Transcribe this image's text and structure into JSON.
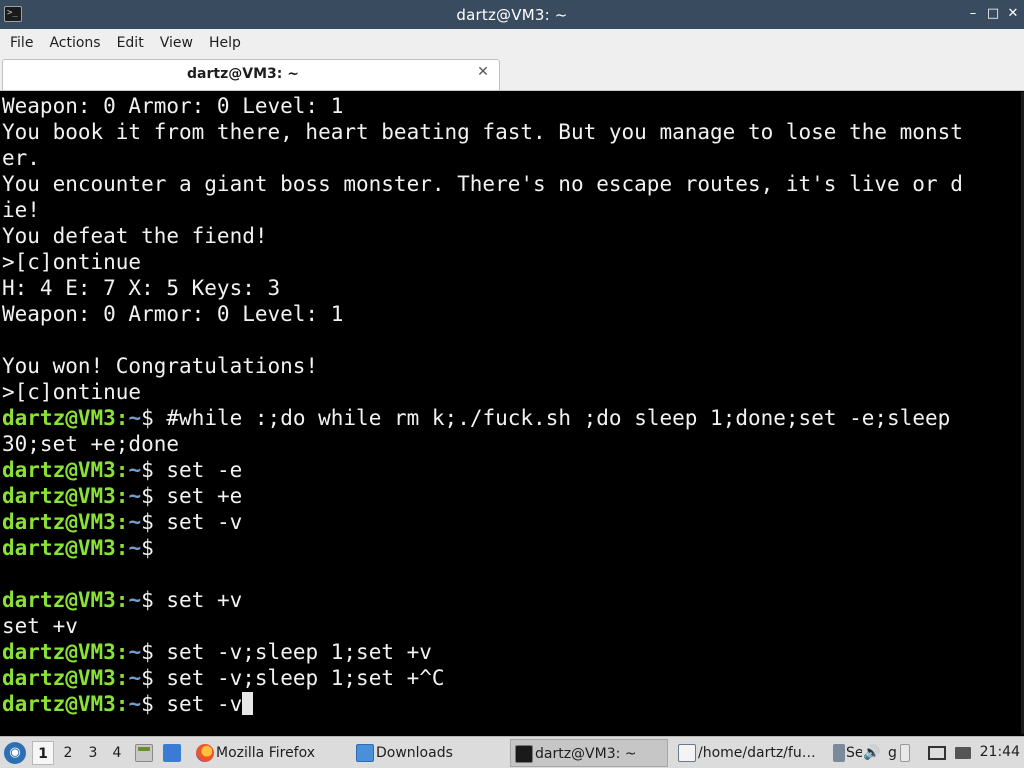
{
  "window": {
    "title": "dartz@VM3: ~",
    "icon_label": ">_",
    "controls": {
      "minimize": "–",
      "maximize": "□",
      "close": "✕"
    }
  },
  "menubar": {
    "items": [
      "File",
      "Actions",
      "Edit",
      "View",
      "Help"
    ]
  },
  "tabs": [
    {
      "label": "dartz@VM3: ~",
      "close": "✕"
    }
  ],
  "terminal": {
    "colors": {
      "user": "#8ae234",
      "path": "#729fcf",
      "text": "#f2f2f2",
      "background": "#000000"
    },
    "prompt": {
      "user": "dartz@VM3",
      "sep": ":",
      "path": "~",
      "symbol": "$ "
    },
    "lines": [
      {
        "text": "Weapon: 0 Armor: 0 Level: 1"
      },
      {
        "text": "You book it from there, heart beating fast. But you manage to lose the monst"
      },
      {
        "text": "er."
      },
      {
        "text": "You encounter a giant boss monster. There's no escape routes, it's live or d"
      },
      {
        "text": "ie!"
      },
      {
        "text": "You defeat the fiend!"
      },
      {
        "text": ">[c]ontinue"
      },
      {
        "text": "H: 4 E: 7 X: 5 Keys: 3"
      },
      {
        "text": "Weapon: 0 Armor: 0 Level: 1"
      },
      {
        "text": ""
      },
      {
        "text": "You won! Congratulations!"
      },
      {
        "text": ">[c]ontinue"
      },
      {
        "prompt": true,
        "text": "#while :;do while rm k;./fuck.sh ;do sleep 1;done;set -e;sleep"
      },
      {
        "text": "30;set +e;done"
      },
      {
        "prompt": true,
        "text": "set -e"
      },
      {
        "prompt": true,
        "text": "set +e"
      },
      {
        "prompt": true,
        "text": "set -v"
      },
      {
        "prompt": true,
        "text": ""
      },
      {
        "text": ""
      },
      {
        "prompt": true,
        "text": "set +v"
      },
      {
        "text": "set +v"
      },
      {
        "prompt": true,
        "text": "set -v;sleep 1;set +v"
      },
      {
        "prompt": true,
        "text": "set -v;sleep 1;set +^C"
      },
      {
        "prompt": true,
        "text": "set -v",
        "cursor": true
      }
    ]
  },
  "taskbar": {
    "workspaces": [
      "1",
      "2",
      "3",
      "4"
    ],
    "active_workspace": "1",
    "tasks": [
      {
        "label": "Mozilla Firefox",
        "icon": "firefox-icon"
      },
      {
        "label": "Downloads",
        "icon": "folder-icon"
      },
      {
        "label": "dartz@VM3: ~",
        "icon": "terminal-icon",
        "active": true
      },
      {
        "label": "/home/dartz/fu…",
        "icon": "text-editor-icon"
      },
      {
        "label": "Se",
        "icon": "settings-icon"
      },
      {
        "label": "g",
        "icon": "app-icon"
      }
    ],
    "clock": "21:44"
  }
}
